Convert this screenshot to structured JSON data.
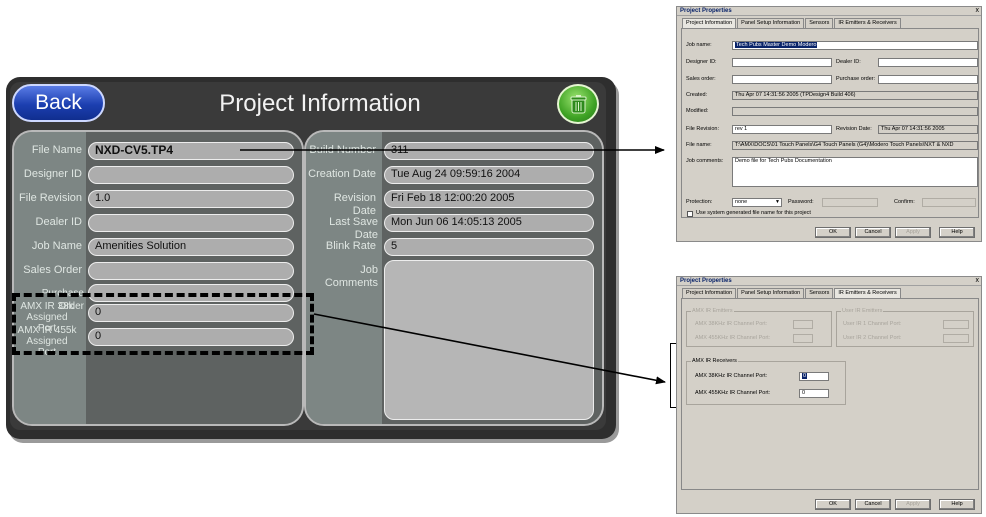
{
  "panel": {
    "back_label": "Back",
    "title": "Project Information",
    "left_fields": [
      {
        "label": "File Name",
        "value": "NXD-CV5.TP4"
      },
      {
        "label": "Designer ID",
        "value": ""
      },
      {
        "label": "File Revision",
        "value": "1.0"
      },
      {
        "label": "Dealer ID",
        "value": ""
      },
      {
        "label": "Job Name",
        "value": "Amenities Solution"
      },
      {
        "label": "Sales Order",
        "value": ""
      },
      {
        "label": "Purchase Order",
        "value": ""
      },
      {
        "label": "AMX IR 38k Assigned Port",
        "value": "0"
      },
      {
        "label": "AMX IR 455k Assigned Port",
        "value": "0"
      }
    ],
    "right_fields": [
      {
        "label": "Build Number",
        "value": "311"
      },
      {
        "label": "Creation Date",
        "value": "Tue Aug 24 09:59:16 2004"
      },
      {
        "label": "Revision Date",
        "value": "Fri Feb 18 12:00:20 2005"
      },
      {
        "label": "Last Save Date",
        "value": "Mon Jun 06 14:05:13 2005"
      },
      {
        "label": "Blink Rate",
        "value": "5"
      },
      {
        "label": "Job Comments",
        "value": ""
      }
    ]
  },
  "dialog_top": {
    "title": "Project Properties",
    "close": "x",
    "tabs": [
      "Project Information",
      "Panel Setup Information",
      "Sensors",
      "IR Emitters & Receivers"
    ],
    "job_name_label": "Job name:",
    "job_name_value": "Tech Pubs Master Demo Modero",
    "designer_id_label": "Designer ID:",
    "dealer_id_label": "Dealer ID:",
    "sales_order_label": "Sales order:",
    "purchase_order_label": "Purchase order:",
    "created_label": "Created:",
    "created_value": "Thu Apr 07 14:31:56 2005 (TPDesign4 Build 406)",
    "modified_label": "Modified:",
    "file_revision_label": "File Revision:",
    "file_revision_value": "rev 1",
    "revision_date_label": "Revision Date:",
    "revision_date_value": "Thu Apr 07 14:31:56 2005",
    "file_name_label": "File name:",
    "file_name_value": "T:\\AMX\\DOCS\\01 Touch Panels\\G4 Touch Panels (G4)\\Modero Touch Panels\\NXT & NXD",
    "job_comments_label": "Job comments:",
    "job_comments_value": "Demo file for Tech Pubs Documentation",
    "protection_label": "Protection:",
    "protection_value": "none",
    "password_label": "Password:",
    "confirm_label": "Confirm:",
    "use_system_label": "Use system generated file name for this project",
    "ok": "OK",
    "cancel": "Cancel",
    "apply": "Apply",
    "help": "Help"
  },
  "dialog_bottom": {
    "title": "Project Properties",
    "close": "x",
    "tabs": [
      "Project Information",
      "Panel Setup Information",
      "Sensors",
      "IR Emitters & Receivers"
    ],
    "amx_emitters_legend": "AMX IR Emitters",
    "amx_emitter_38_label": "AMX 38KHz IR Channel Port:",
    "amx_emitter_455_label": "AMX 455KHz IR Channel Port:",
    "user_emitters_legend": "User IR Emitters",
    "user_ir1_label": "User IR 1 Channel Port:",
    "user_ir2_label": "User IR 2 Channel Port:",
    "amx_receivers_legend": "AMX IR Receivers",
    "receiver_38_label": "AMX 38KHz IR Channel Port:",
    "receiver_38_value": "0",
    "receiver_455_label": "AMX 455KHz IR Channel Port:",
    "receiver_455_value": "0",
    "ok": "OK",
    "cancel": "Cancel",
    "apply": "Apply",
    "help": "Help"
  },
  "colors": {
    "panel_bg": "#2e2e2e",
    "back_button": "#1c3fb0",
    "trash_button": "#3fa324",
    "field_fill": "#adadad",
    "dialog_bg": "#d4d0c8"
  }
}
